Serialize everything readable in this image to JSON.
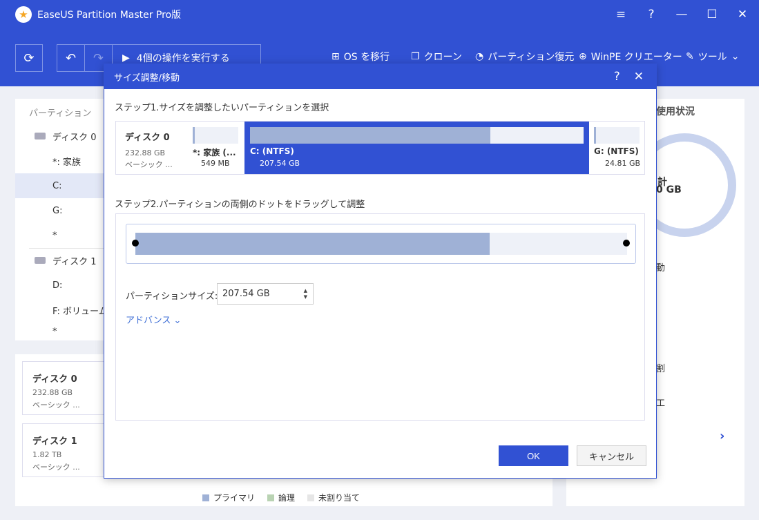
{
  "window": {
    "title": "EaseUS Partition Master Pro版",
    "controls": [
      "≡",
      "?",
      "—",
      "☐",
      "✕"
    ]
  },
  "toolbar": {
    "execute_label": "4個の操作を実行する",
    "menu": {
      "os_migrate": "OS を移行",
      "clone": "クローン",
      "partition_recovery": "パーティション復元",
      "winpe": "WinPE クリエーター",
      "tools": "ツール"
    }
  },
  "sidebar": {
    "header": "パーティション",
    "items": [
      {
        "label": "ディスク 0",
        "type": "disk"
      },
      {
        "label": "*: 家族",
        "type": "partition"
      },
      {
        "label": "C:",
        "type": "partition",
        "selected": true
      },
      {
        "label": "G:",
        "type": "partition"
      },
      {
        "label": "*",
        "type": "partition"
      },
      {
        "label": "ディスク 1",
        "type": "disk"
      },
      {
        "label": "D:",
        "type": "partition"
      },
      {
        "label": "F: ボリューム",
        "type": "partition"
      },
      {
        "label": "*",
        "type": "partition"
      }
    ]
  },
  "disk_cards": [
    {
      "name": "ディスク 0",
      "size": "232.88 GB",
      "type": "ベーシック ..."
    },
    {
      "name": "ディスク 1",
      "size": "1.82 TB",
      "type": "ベーシック ..."
    }
  ],
  "legend": [
    {
      "label": "プライマリ",
      "color": "#9fb1d6"
    },
    {
      "label": "論理",
      "color": "#b9d3b3"
    },
    {
      "label": "未割り当て",
      "color": "#e6e6e6"
    }
  ],
  "right_panel": {
    "title": "使用状況",
    "total_label": "計",
    "total_value": "0 GB",
    "items": [
      "動",
      "割",
      "工"
    ]
  },
  "dialog": {
    "title": "サイズ調整/移動",
    "step1": "ステップ1.サイズを調整したいパーティションを選択",
    "step2": "ステップ2.パーティションの両側のドットをドラッグして調整",
    "disk": {
      "name": "ディスク 0",
      "size": "232.88 GB",
      "type": "ベーシック ..."
    },
    "partitions": [
      {
        "name": "*: 家族 (...",
        "size": "549 MB",
        "used_fraction": 0.05
      },
      {
        "name": "C: (NTFS)",
        "size": "207.54 GB",
        "used_fraction": 0.72,
        "selected": true
      },
      {
        "name": "G: (NTFS)",
        "size": "24.81 GB",
        "used_fraction": 0.05
      }
    ],
    "slider_used_fraction": 0.72,
    "size_label": "パーティションサイズ:",
    "size_value": "207.54 GB",
    "advanced": "アドバンス",
    "ok": "OK",
    "cancel": "キャンセル"
  },
  "colors": {
    "brand": "#3151d3",
    "primary_partition": "#9fb1d6"
  }
}
